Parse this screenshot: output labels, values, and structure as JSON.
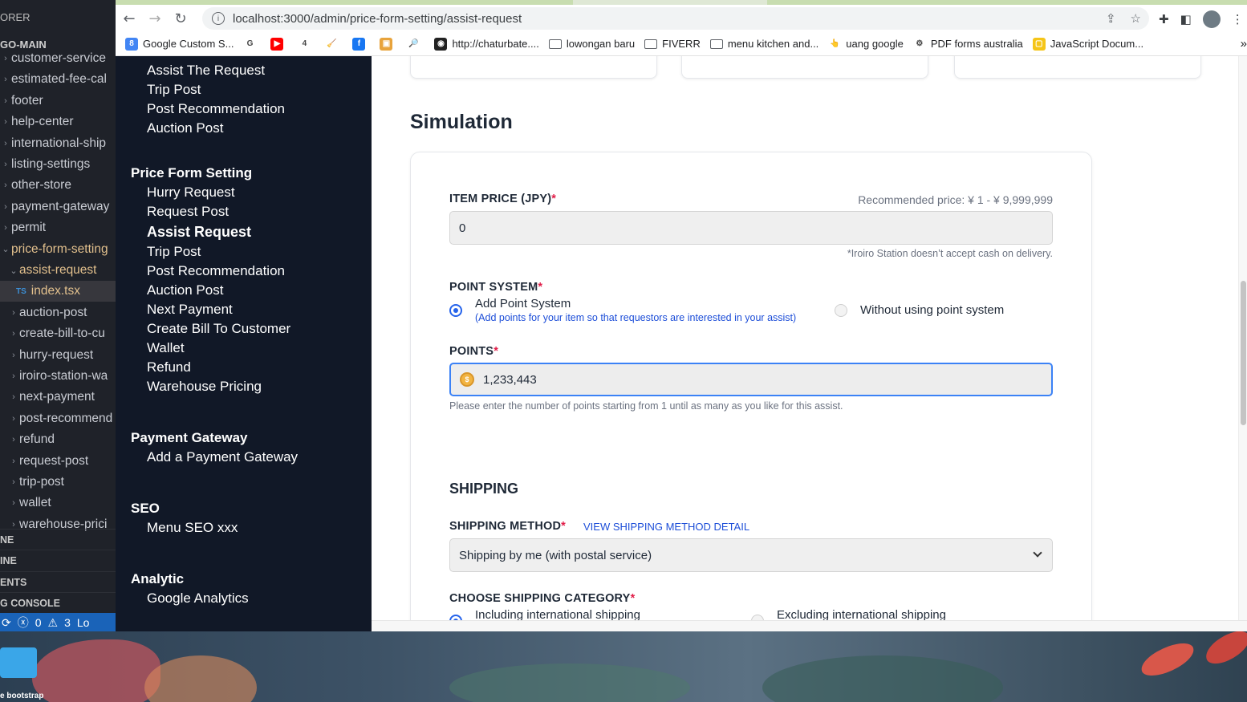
{
  "vscode": {
    "title": "ORER",
    "root": "GO-MAIN",
    "tree": [
      {
        "label": "customer-service",
        "open": false
      },
      {
        "label": "estimated-fee-cal",
        "open": false
      },
      {
        "label": "footer",
        "open": false
      },
      {
        "label": "help-center",
        "open": false
      },
      {
        "label": "international-ship",
        "open": false
      },
      {
        "label": "listing-settings",
        "open": false
      },
      {
        "label": "other-store",
        "open": false
      },
      {
        "label": "payment-gateway",
        "open": false
      },
      {
        "label": "permit",
        "open": false
      },
      {
        "label": "price-form-setting",
        "open": true
      },
      {
        "label": "assist-request",
        "open": true
      },
      {
        "label": "index.tsx",
        "open": false
      },
      {
        "label": "auction-post",
        "open": false
      },
      {
        "label": "create-bill-to-cu",
        "open": false
      },
      {
        "label": "hurry-request",
        "open": false
      },
      {
        "label": "iroiro-station-wa",
        "open": false
      },
      {
        "label": "next-payment",
        "open": false
      },
      {
        "label": "post-recommend",
        "open": false
      },
      {
        "label": "refund",
        "open": false
      },
      {
        "label": "request-post",
        "open": false
      },
      {
        "label": "trip-post",
        "open": false
      },
      {
        "label": "wallet",
        "open": false
      },
      {
        "label": "warehouse-prici",
        "open": false
      }
    ],
    "sections": [
      "NE",
      "INE",
      "ENTS",
      "G CONSOLE"
    ],
    "status": {
      "errors": "0",
      "warnings": "3",
      "extra": "Lo"
    },
    "ts_badge": "TS"
  },
  "desktop": {
    "label": "e bootstrap"
  },
  "browser": {
    "url": "localhost:3000/admin/price-form-setting/assist-request",
    "bookmarks": [
      {
        "label": "Google Custom S...",
        "color": "#4285f4",
        "glyph": "8"
      },
      {
        "label": "",
        "color": "#ffffff",
        "glyph": "G"
      },
      {
        "label": "",
        "color": "#ff0000",
        "glyph": "▶"
      },
      {
        "label": "",
        "color": "#ffffff",
        "glyph": "4"
      },
      {
        "label": "",
        "color": "#ffffff",
        "glyph": "🧹"
      },
      {
        "label": "",
        "color": "#1877f2",
        "glyph": "f"
      },
      {
        "label": "",
        "color": "#e8a33b",
        "glyph": "▣"
      },
      {
        "label": "",
        "color": "#ffffff",
        "glyph": "🔎"
      },
      {
        "label": "http://chaturbate....",
        "color": "#222222",
        "glyph": "◉"
      },
      {
        "label": "lowongan baru",
        "color": "folder",
        "glyph": ""
      },
      {
        "label": "FIVERR",
        "color": "folder",
        "glyph": ""
      },
      {
        "label": "menu kitchen and...",
        "color": "folder",
        "glyph": ""
      },
      {
        "label": "uang google",
        "color": "#ffffff",
        "glyph": "👆"
      },
      {
        "label": "PDF forms australia",
        "color": "#ffffff",
        "glyph": "⚙"
      },
      {
        "label": "JavaScript Docum...",
        "color": "#f5c518",
        "glyph": "▢"
      }
    ],
    "more": "»"
  },
  "sidebar": {
    "top_items": [
      "Assist The Request",
      "Trip Post",
      "Post Recommendation",
      "Auction Post"
    ],
    "groups": [
      {
        "title": "Price Form Setting",
        "items": [
          "Hurry Request",
          "Request Post",
          "Assist Request",
          "Trip Post",
          "Post Recommendation",
          "Auction Post",
          "Next Payment",
          "Create Bill To Customer",
          "Wallet",
          "Refund",
          "Warehouse Pricing"
        ],
        "active": "Assist Request"
      },
      {
        "title": "Payment Gateway",
        "items": [
          "Add a Payment Gateway"
        ]
      },
      {
        "title": "SEO",
        "items": [
          "Menu SEO xxx"
        ]
      },
      {
        "title": "Analytic",
        "items": [
          "Google Analytics"
        ]
      }
    ]
  },
  "main": {
    "heading": "Simulation",
    "item_price": {
      "label": "ITEM PRICE (JPY)",
      "required": "*",
      "recommended": "Recommended price: ¥ 1 - ¥ 9,999,999",
      "value": "0",
      "note": "*Iroiro Station doesn’t accept cash on delivery."
    },
    "point_system": {
      "label": "POINT SYSTEM",
      "required": "*",
      "option_add": "Add Point System",
      "option_add_sub": "(Add points for your item so that requestors are interested in your assist)",
      "option_without": "Without using point system",
      "selected": "add"
    },
    "points": {
      "label": "POINTS",
      "required": "*",
      "value": "1,233,443",
      "help": "Please enter the number of points starting from 1 until as many as you like for this assist."
    },
    "shipping": {
      "title": "SHIPPING",
      "method_label": "SHIPPING METHOD",
      "required": "*",
      "method_link": "VIEW SHIPPING METHOD DETAIL",
      "method_value": "Shipping by me (with postal service)",
      "category_label": "CHOOSE SHIPPING CATEGORY",
      "category_option_1": "Including international shipping",
      "category_option_2": "Excluding international shipping"
    }
  }
}
